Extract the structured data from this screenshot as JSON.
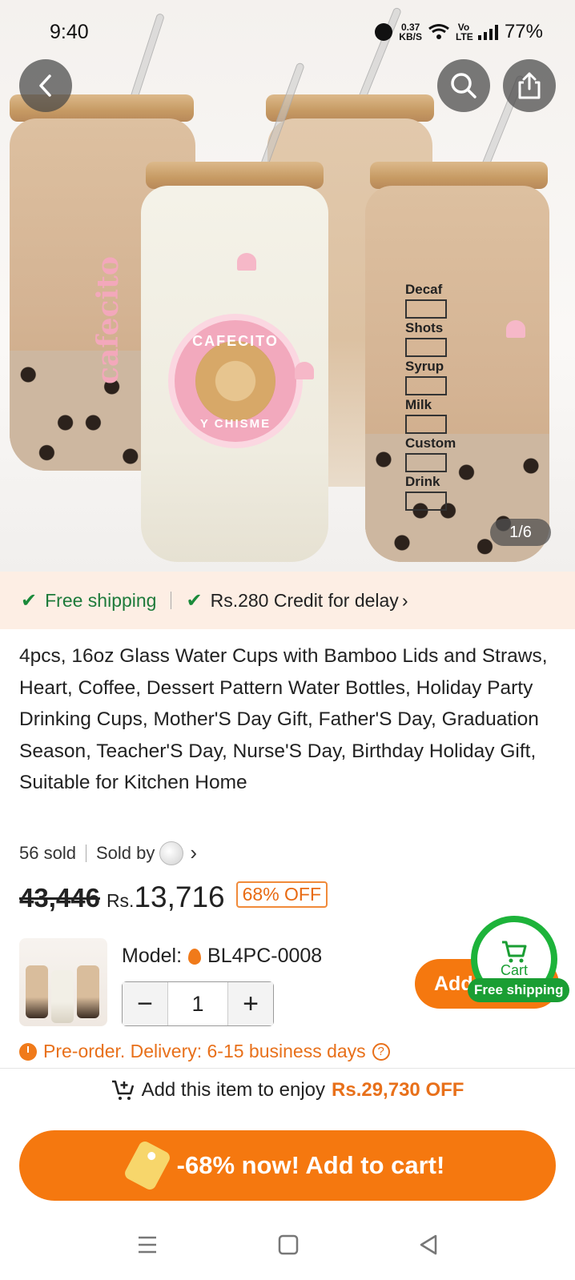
{
  "status_bar": {
    "time": "9:40",
    "net_speed": "0.37",
    "net_unit": "KB/S",
    "lte": "Vo LTE",
    "battery": "77%"
  },
  "gallery": {
    "counter": "1/6",
    "jar_texts": {
      "cafecito": "cafecito",
      "seal_top": "CAFECITO",
      "seal_bottom": "Y CHISME",
      "checklist": [
        "Decaf",
        "Shots",
        "Syrup",
        "Milk",
        "Custom",
        "Drink"
      ]
    }
  },
  "shipping": {
    "free_shipping": "Free shipping",
    "credit": "Rs.280 Credit for delay",
    "check_color": "#1a8a3a"
  },
  "product": {
    "title": "4pcs, 16oz Glass Water Cups with Bamboo Lids and Straws, Heart, Coffee, Dessert Pattern Water Bottles, Holiday Party Drinking Cups, Mother'S Day Gift, Father'S Day, Graduation Season, Teacher'S Day, Nurse'S Day, Birthday Holiday Gift, Suitable for Kitchen Home",
    "sold": "56 sold",
    "sold_by": "Sold by"
  },
  "price": {
    "original": "43,446",
    "currency": "Rs.",
    "current": "13,716",
    "discount": "68% OFF"
  },
  "variant": {
    "model_label": "Model:",
    "model_value": "BL4PC-0008",
    "quantity": "1",
    "add_button": "Add",
    "cart_label": "Cart",
    "cart_badge": "Free shipping"
  },
  "delivery": {
    "text": "Pre-order. Delivery: 6-15 business days"
  },
  "promo": {
    "text": "Add this item to enjoy",
    "amount": "Rs.29,730 OFF"
  },
  "cta": {
    "label": "-68% now! Add to cart!",
    "color": "#f5780f"
  },
  "colors": {
    "accent": "#f5780f",
    "success": "#1db33a",
    "strip_bg": "#fdeee4"
  }
}
